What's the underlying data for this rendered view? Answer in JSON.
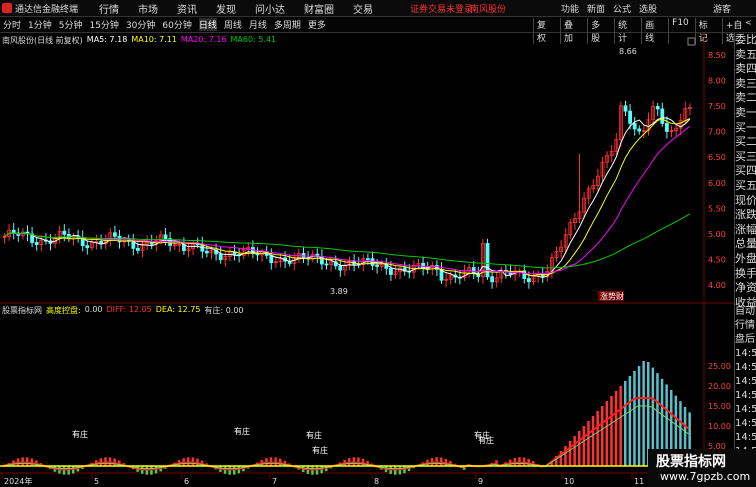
{
  "app": {
    "name": "通达信金融终端"
  },
  "menu": [
    "行情",
    "市场",
    "资讯",
    "发现",
    "问小达",
    "财富圈",
    "交易"
  ],
  "header": {
    "warning": "证券交易未登录",
    "stock": "南风股份"
  },
  "right_menu": [
    "功能",
    "新面",
    "公式",
    "选股"
  ],
  "guest": "游客",
  "periods": [
    "分时",
    "1分钟",
    "5分钟",
    "15分钟",
    "30分钟",
    "60分钟",
    "日线",
    "周线",
    "月线",
    "多周期",
    "更多"
  ],
  "active_period": "日线",
  "tools": [
    "复权",
    "叠加",
    "多股",
    "统计",
    "画线",
    "F10",
    "标记",
    "+自选"
  ],
  "pager": "<",
  "legend": {
    "title": "南风股份(日线 前复权)",
    "ma5": "MA5: 7.18",
    "ma10": "MA10: 7.11",
    "ma20": "MA20: 7.16",
    "ma60": "MA60: 5.41"
  },
  "colors": {
    "ma5": "#ffffff",
    "ma10": "#ffff00",
    "ma20": "#ff00ff",
    "ma60": "#00c800",
    "up": "#ff3232",
    "down": "#54ffff"
  },
  "y_axis": [
    "8.50",
    "8.00",
    "7.50",
    "7.00",
    "6.50",
    "6.00",
    "5.50",
    "5.00",
    "4.50",
    "4.00"
  ],
  "price_annotations": {
    "high": "8.66",
    "low": "3.89",
    "tag": "涨势财"
  },
  "indicator": {
    "title": "股票指标网",
    "control_label": "高度控盘:",
    "control_value": "0.00",
    "diff": "DIFF: 12.05",
    "dea": "DEA: 12.75",
    "youzhuang": "有庄: 0.00",
    "y_axis": [
      "25.00",
      "20.00",
      "15.00",
      "10.00",
      "5.00",
      "0.00"
    ],
    "labels": [
      "有庄",
      "有庄",
      "有庄",
      "有庄",
      "有庄",
      "有庄"
    ]
  },
  "x_axis": [
    "2024年",
    "5",
    "6",
    "7",
    "8",
    "9",
    "10",
    "11"
  ],
  "side_panel": [
    "委比",
    "卖五",
    "卖四",
    "卖三",
    "卖二",
    "卖一",
    "买一",
    "买二",
    "买三",
    "买四",
    "买五",
    "现价",
    "涨跌",
    "涨幅",
    "总量",
    "外盘",
    "换手",
    "净资",
    "收益"
  ],
  "side_panel2": [
    "自动",
    "行情",
    "盘后",
    "14:50",
    "14:50",
    "14:50",
    "14:50",
    "14:50",
    "14:50",
    "14:50",
    "14:50"
  ],
  "watermark": {
    "line1": "股票指标网",
    "line2": "www.7gpzb.com"
  }
}
